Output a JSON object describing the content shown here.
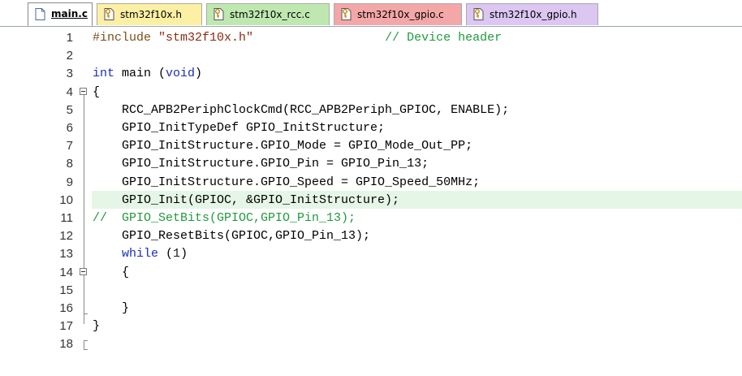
{
  "tabs": [
    {
      "label": "main.c",
      "icon": "document-icon",
      "color": "#ffffff",
      "active": true
    },
    {
      "label": "stm32f10x.h",
      "icon": "key-document-icon",
      "color": "#fbf0a4",
      "active": false
    },
    {
      "label": "stm32f10x_rcc.c",
      "icon": "key-document-icon",
      "color": "#bfe8b0",
      "active": false
    },
    {
      "label": "stm32f10x_gpio.c",
      "icon": "key-document-icon",
      "color": "#f4a7a7",
      "active": false
    },
    {
      "label": "stm32f10x_gpio.h",
      "icon": "key-document-icon",
      "color": "#dcc6f2",
      "active": false
    }
  ],
  "editor": {
    "highlighted_line": 10,
    "lines": [
      {
        "n": "1",
        "tokens": [
          [
            "pp",
            "#include "
          ],
          [
            "str",
            "\"stm32f10x.h\""
          ],
          [
            "",
            "                  "
          ],
          [
            "cmt",
            "// Device header"
          ]
        ]
      },
      {
        "n": "2",
        "tokens": []
      },
      {
        "n": "3",
        "tokens": [
          [
            "kw",
            "int"
          ],
          [
            "",
            " main ("
          ],
          [
            "kw",
            "void"
          ],
          [
            "",
            ")"
          ]
        ]
      },
      {
        "n": "4",
        "tokens": [
          [
            "",
            "{"
          ]
        ]
      },
      {
        "n": "5",
        "tokens": [
          [
            "",
            "    RCC_APB2PeriphClockCmd(RCC_APB2Periph_GPIOC, ENABLE);"
          ]
        ]
      },
      {
        "n": "6",
        "tokens": [
          [
            "",
            "    GPIO_InitTypeDef GPIO_InitStructure;"
          ]
        ]
      },
      {
        "n": "7",
        "tokens": [
          [
            "",
            "    GPIO_InitStructure.GPIO_Mode = GPIO_Mode_Out_PP;"
          ]
        ]
      },
      {
        "n": "8",
        "tokens": [
          [
            "",
            "    GPIO_InitStructure.GPIO_Pin = GPIO_Pin_13;"
          ]
        ]
      },
      {
        "n": "9",
        "tokens": [
          [
            "",
            "    GPIO_InitStructure.GPIO_Speed = GPIO_Speed_50MHz;"
          ]
        ]
      },
      {
        "n": "10",
        "tokens": [
          [
            "",
            "    GPIO_Init(GPIOC, &GPIO_InitStructure);"
          ]
        ]
      },
      {
        "n": "11",
        "tokens": [
          [
            "cmt",
            "//  GPIO_SetBits(GPIOC,GPIO_Pin_13);"
          ]
        ]
      },
      {
        "n": "12",
        "tokens": [
          [
            "",
            "    GPIO_ResetBits(GPIOC,GPIO_Pin_13);"
          ]
        ]
      },
      {
        "n": "13",
        "tokens": [
          [
            "",
            "    "
          ],
          [
            "kw",
            "while"
          ],
          [
            "",
            " ("
          ],
          [
            "num",
            "1"
          ],
          [
            "",
            ")"
          ]
        ]
      },
      {
        "n": "14",
        "tokens": [
          [
            "",
            "    {"
          ]
        ]
      },
      {
        "n": "15",
        "tokens": []
      },
      {
        "n": "16",
        "tokens": [
          [
            "",
            "    }"
          ]
        ]
      },
      {
        "n": "17",
        "tokens": [
          [
            "",
            "}"
          ]
        ]
      },
      {
        "n": "18",
        "tokens": []
      }
    ]
  }
}
